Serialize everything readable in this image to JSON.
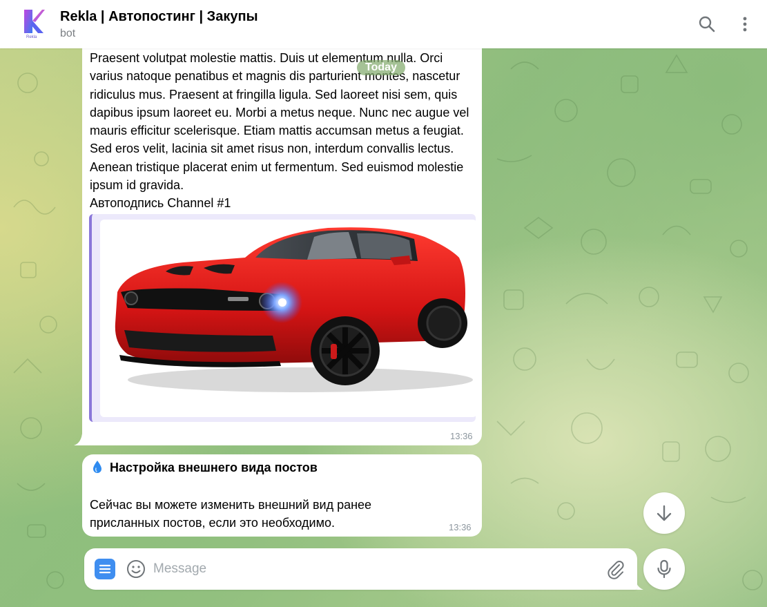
{
  "header": {
    "title": "Rekla | Автопостинг | Закупы",
    "subtitle": "bot",
    "avatar_caption": "Rekla",
    "search_icon": "search-icon",
    "menu_icon": "more-vertical-icon"
  },
  "chat": {
    "date_badge": "Today",
    "messages": [
      {
        "text": "Praesent volutpat molestie mattis. Duis ut elementum nulla. Orci varius natoque penatibus et magnis dis parturient montes, nascetur ridiculus mus. Praesent at fringilla ligula. Sed laoreet nisi sem, quis dapibus ipsum laoreet eu. Morbi a metus neque. Nunc nec augue vel mauris efficitur scelerisque. Etiam mattis accumsan metus a feugiat. Sed eros velit, lacinia sit amet risus non, interdum convallis lectus. Aenean tristique placerat enim ut fermentum. Sed euismod molestie ipsum id gravida.",
        "signature": "Автоподпись Channel #1",
        "preview_image": "red-muscle-car-photo",
        "time": "13:36"
      },
      {
        "title_emoji": "droplet-icon",
        "title": "Настройка внешнего вида постов",
        "body": "Сейчас вы можете изменить внешний вид ранее присланных постов, если это необходимо.",
        "time": "13:36"
      }
    ]
  },
  "composer": {
    "placeholder": "Message",
    "menu_icon": "menu-icon",
    "emoji_icon": "smile-icon",
    "attach_icon": "paperclip-icon",
    "mic_icon": "microphone-icon"
  },
  "scroll_down_icon": "arrow-down-icon",
  "colors": {
    "accent": "#3f8ef0",
    "preview_border": "#8a77d9",
    "preview_bg": "#ece9fb",
    "date_badge_bg": "#82aa6e",
    "timestamp": "#8c969e"
  }
}
